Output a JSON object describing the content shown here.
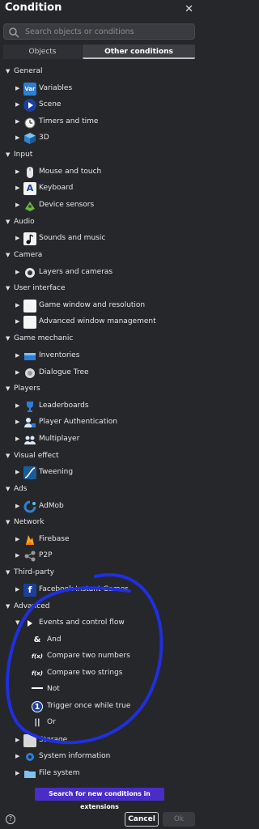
{
  "header": {
    "title": "Condition",
    "close": "✕"
  },
  "search": {
    "placeholder": "Search objects or conditions"
  },
  "tabs": {
    "objects": "Objects",
    "other": "Other conditions"
  },
  "categories": {
    "general": "General",
    "input": "Input",
    "audio": "Audio",
    "camera": "Camera",
    "ui": "User interface",
    "mechanic": "Game mechanic",
    "players": "Players",
    "visual": "Visual effect",
    "ads": "Ads",
    "network": "Network",
    "thirdparty": "Third-party",
    "advanced": "Advanced"
  },
  "items": {
    "variables": "Variables",
    "scene": "Scene",
    "timers": "Timers and time",
    "threed": "3D",
    "mouse": "Mouse and touch",
    "keyboard": "Keyboard",
    "device": "Device sensors",
    "sounds": "Sounds and music",
    "layers": "Layers and cameras",
    "window": "Game window and resolution",
    "advwindow": "Advanced window management",
    "inventories": "Inventories",
    "dialogue": "Dialogue Tree",
    "leaderboards": "Leaderboards",
    "auth": "Player Authentication",
    "multiplayer": "Multiplayer",
    "tweening": "Tweening",
    "admob": "AdMob",
    "firebase": "Firebase",
    "p2p": "P2P",
    "facebook": "Facebook Instant Games",
    "events": "Events and control flow",
    "storage": "Storage",
    "system": "System information",
    "filesystem": "File system"
  },
  "events_sub": {
    "and": "And",
    "compare_numbers": "Compare two numbers",
    "compare_strings": "Compare two strings",
    "not": "Not",
    "trigger_once": "Trigger once while true",
    "or": "Or"
  },
  "icons": {
    "variables_text": "Var",
    "and_glyph": "&",
    "fx_glyph": "f(x)",
    "one_glyph": "1",
    "or_glyph": "||"
  },
  "extensions_button": "Search for new conditions in extensions",
  "footer": {
    "help": "?",
    "cancel": "Cancel",
    "ok": "Ok"
  },
  "colors": {
    "background": "#26272b",
    "accent": "#4a2cc9",
    "scribble": "#1f2fe0"
  }
}
